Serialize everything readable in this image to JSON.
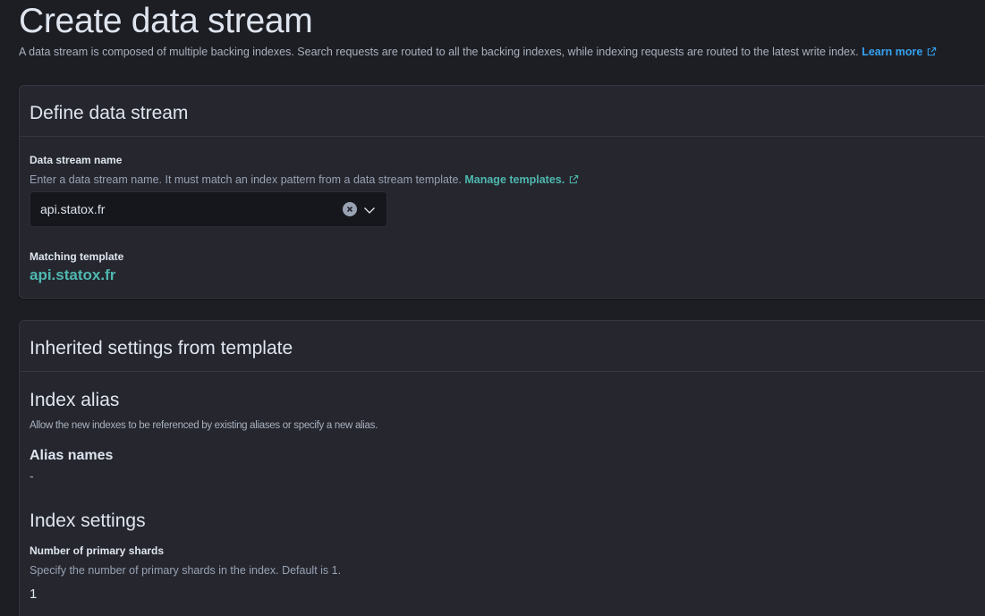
{
  "header": {
    "title": "Create data stream",
    "description": "A data stream is composed of multiple backing indexes. Search requests are routed to all the backing indexes, while indexing requests are routed to the latest write index.",
    "learn_more": "Learn more"
  },
  "define_panel": {
    "title": "Define data stream",
    "name_field": {
      "label": "Data stream name",
      "help": "Enter a data stream name. It must match an index pattern from a data stream template.",
      "manage_link": "Manage templates.",
      "value": "api.statox.fr"
    },
    "matching": {
      "label": "Matching template",
      "value": "api.statox.fr"
    }
  },
  "inherited_panel": {
    "title": "Inherited settings from template",
    "index_alias": {
      "title": "Index alias",
      "description": "Allow the new indexes to be referenced by existing aliases or specify a new alias.",
      "alias_label": "Alias names",
      "alias_value": "-"
    },
    "index_settings": {
      "title": "Index settings",
      "shards_label": "Number of primary shards",
      "shards_help": "Specify the number of primary shards in the index. Default is 1.",
      "shards_value": "1"
    }
  },
  "icons": {
    "external": "external-link-icon",
    "clear": "clear-icon",
    "chevron": "chevron-down-icon"
  },
  "colors": {
    "background": "#1d1e24",
    "panel": "#25262e",
    "link_blue": "#36a2ef",
    "link_teal": "#4fb8b0"
  }
}
